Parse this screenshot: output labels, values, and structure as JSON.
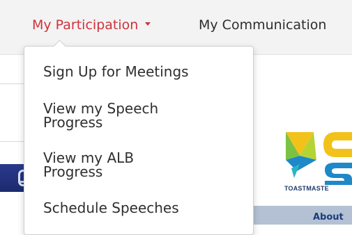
{
  "nav": {
    "items": [
      {
        "label": "My Participation",
        "active": true,
        "has_caret": true
      },
      {
        "label": "My Communication",
        "active": false,
        "has_caret": false
      }
    ]
  },
  "dropdown": {
    "items": [
      {
        "label": "Sign Up for Meetings"
      },
      {
        "label": "View my Speech\nProgress"
      },
      {
        "label": "View my ALB\nProgress"
      },
      {
        "label": "Schedule Speeches"
      }
    ]
  },
  "logo": {
    "caption": "TOASTMASTE",
    "colors": {
      "green": "#7cc242",
      "blue": "#1e88c8",
      "teal": "#2bb3c6",
      "yellow": "#f2c21a",
      "lime": "#b5d335"
    }
  },
  "footer": {
    "about_label": "About"
  },
  "colors": {
    "accent": "#d2313b",
    "nav_text": "#2d2d2d",
    "navbar_bg": "#f3f3f3"
  }
}
